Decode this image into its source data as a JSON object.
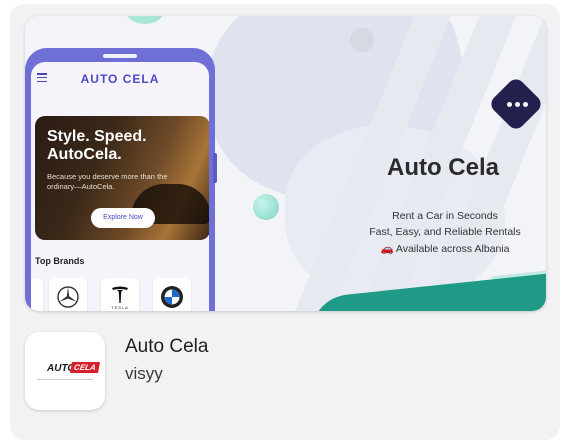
{
  "banner": {
    "title": "Auto Cela",
    "tagline_1": "Rent a Car in Seconds",
    "tagline_2": "Fast, Easy, and Reliable Rentals",
    "tagline_3": "🚗 Available across Albania"
  },
  "phone": {
    "app_title": "AUTO CELA",
    "hero_title": "Style. Speed. AutoCela.",
    "hero_subtitle": "Because you deserve more than the ordinary—AutoCela.",
    "hero_button": "Explore Now",
    "brands_title": "Top Brands",
    "brand_items": [
      "mercedes-logo-icon",
      "tesla-logo-icon",
      "bmw-logo-icon"
    ],
    "tesla_label": "TESLA"
  },
  "app": {
    "name": "Auto Cela",
    "developer": "visyy",
    "logo_word_1": "AUTO",
    "logo_word_2": "CELA"
  },
  "colors": {
    "phone_frame": "#6f6fd8",
    "accent_indigo": "#4a4ac8",
    "teal_wave": "#1e9a86",
    "badge": "#23204e",
    "logo_red": "#d8202a"
  }
}
